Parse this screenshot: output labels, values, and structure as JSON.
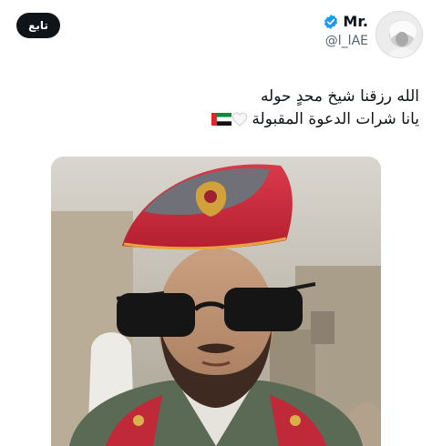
{
  "header": {
    "display_name": "Mr.",
    "handle": "@l_lAE",
    "follow_label": "تابع"
  },
  "tweet": {
    "line1": "الله رزقنا شيخ محدٍ حوله",
    "line2": "يانا شرات الدعوة المقبولة",
    "emojis": [
      "white-heart-icon",
      "uae-flag-icon"
    ]
  },
  "colors": {
    "follow_bg": "#0f1419",
    "verified": "#1d9bf0",
    "handle": "#536471",
    "cap_red": "#c8283a"
  }
}
